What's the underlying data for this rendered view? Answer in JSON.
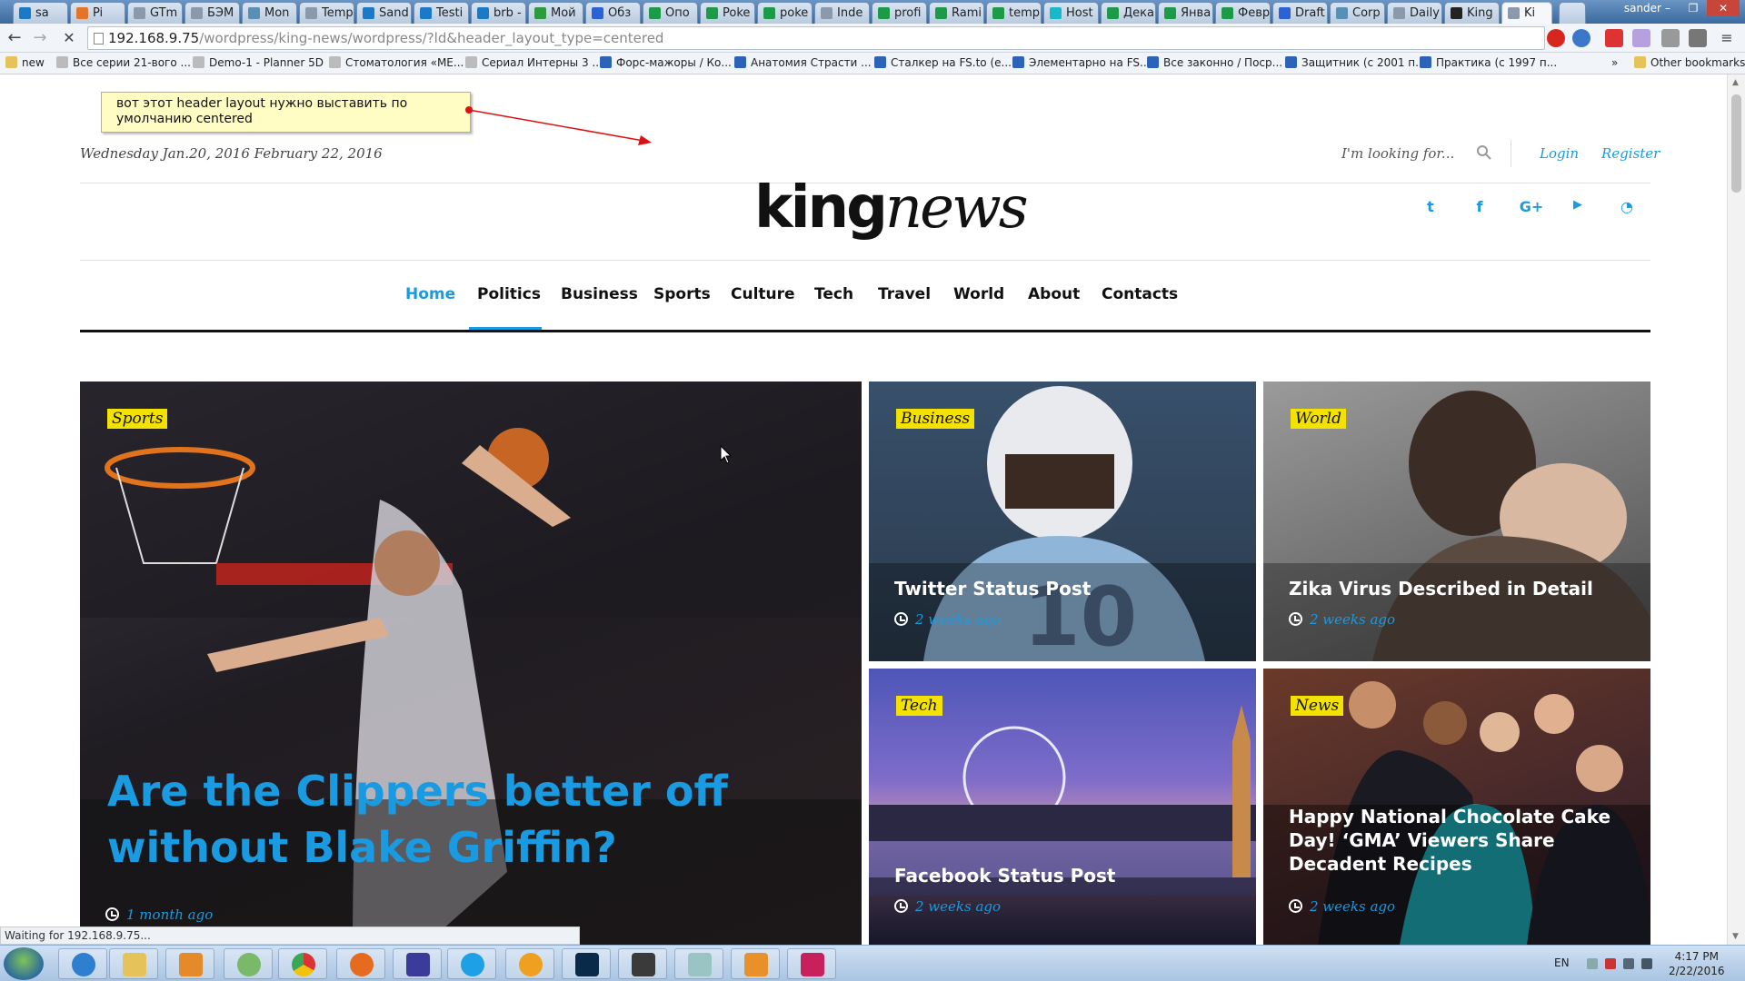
{
  "browser": {
    "tabs": [
      {
        "label": "sa",
        "color": "#1a7ac7"
      },
      {
        "label": "Pi",
        "color": "#e3742b"
      },
      {
        "label": "GTm",
        "color": "#8a9aaa"
      },
      {
        "label": "БЭМ",
        "color": "#8a9aaa"
      },
      {
        "label": "Mon",
        "color": "#5a8fb5"
      },
      {
        "label": "Temp",
        "color": "#8a9aaa"
      },
      {
        "label": "Sand",
        "color": "#1a7ac7"
      },
      {
        "label": "Testi",
        "color": "#1a7ac7"
      },
      {
        "label": "brb -",
        "color": "#1a7ac7"
      },
      {
        "label": "Мой",
        "color": "#2e9a3f"
      },
      {
        "label": "Обз",
        "color": "#2b63d6"
      },
      {
        "label": "Опо",
        "color": "#1d9a48"
      },
      {
        "label": "Poke",
        "color": "#1d9a48"
      },
      {
        "label": "poke",
        "color": "#1d9a48"
      },
      {
        "label": "Inde",
        "color": "#8a9aaa"
      },
      {
        "label": "profi",
        "color": "#1d9a48"
      },
      {
        "label": "Rami",
        "color": "#1d9a48"
      },
      {
        "label": "temp",
        "color": "#1d9a48"
      },
      {
        "label": "Host",
        "color": "#18b8c8"
      },
      {
        "label": "Дека",
        "color": "#1d9a48"
      },
      {
        "label": "Янва",
        "color": "#1d9a48"
      },
      {
        "label": "Февр",
        "color": "#1d9a48"
      },
      {
        "label": "Draft",
        "color": "#2b63d6"
      },
      {
        "label": "Corp",
        "color": "#5a8fb5"
      },
      {
        "label": "Daily",
        "color": "#8a9aaa"
      },
      {
        "label": "King",
        "color": "#222222"
      },
      {
        "label": "Ki",
        "color": "#8a9aaa"
      }
    ],
    "active_tab_index": 26,
    "user": "sander",
    "url_host": "192.168.9.75",
    "url_path": "/wordpress/king-news/wordpress/?ld&header_layout_type=centered",
    "status_text": "Waiting for 192.168.9.75...",
    "bookmarks": [
      {
        "label": "new",
        "icon": "folder-icon"
      },
      {
        "label": "Все серии 21-вого ...",
        "icon": "page-icon"
      },
      {
        "label": "Demo-1 - Planner 5D",
        "icon": "page-icon"
      },
      {
        "label": "Стоматология «МЕ...",
        "icon": "page-icon"
      },
      {
        "label": "Сериал Интерны 3 ...",
        "icon": "page-icon"
      },
      {
        "label": "Форс-мажоры / Ко...",
        "icon": "arrow-up-icon"
      },
      {
        "label": "Анатомия Страсти ...",
        "icon": "arrow-up-icon"
      },
      {
        "label": "Сталкер на FS.to (e...",
        "icon": "arrow-up-icon"
      },
      {
        "label": "Элементарно на FS...",
        "icon": "arrow-up-icon"
      },
      {
        "label": "Все законно / Поср...",
        "icon": "arrow-up-icon"
      },
      {
        "label": "Защитник (с 2001 п...",
        "icon": "arrow-up-icon"
      },
      {
        "label": "Практика (с 1997 п...",
        "icon": "arrow-up-icon"
      },
      {
        "label": "Other bookmarks",
        "icon": "folder-icon"
      }
    ],
    "overflow_label": "»"
  },
  "note": {
    "text": "вот этот header layout нужно выставить по умолчанию centered"
  },
  "site": {
    "date": "Wednesday Jan.20, 2016 February 22, 2016",
    "search_placeholder": "I'm looking for...",
    "login": "Login",
    "register": "Register",
    "logo_bold": "king",
    "logo_italic": "news",
    "social": [
      "twitter-icon",
      "facebook-icon",
      "google-plus-icon",
      "youtube-icon",
      "rss-icon"
    ],
    "menu": [
      "Home",
      "Politics",
      "Business",
      "Sports",
      "Culture",
      "Tech",
      "Travel",
      "World",
      "About",
      "Contacts"
    ],
    "active_menu": "Home",
    "accent_color": "#1a9ae0",
    "tag_color": "#f3e100"
  },
  "posts": {
    "featured": {
      "category": "Sports",
      "title": "Are the Clippers better off without Blake Griffin?",
      "time": "1 month ago"
    },
    "p1": {
      "category": "Business",
      "title": "Twitter Status Post",
      "time": "2 weeks ago"
    },
    "p2": {
      "category": "World",
      "title": "Zika Virus Described in Detail",
      "time": "2 weeks ago"
    },
    "p3": {
      "category": "Tech",
      "title": "Facebook Status Post",
      "time": "2 weeks ago"
    },
    "p4": {
      "category": "News",
      "title": "Happy National Chocolate Cake Day! ‘GMA’ Viewers Share Decadent Recipes",
      "time": "2 weeks ago"
    }
  },
  "taskbar": {
    "lang": "EN",
    "time": "4:17 PM",
    "date": "2/22/2016"
  }
}
